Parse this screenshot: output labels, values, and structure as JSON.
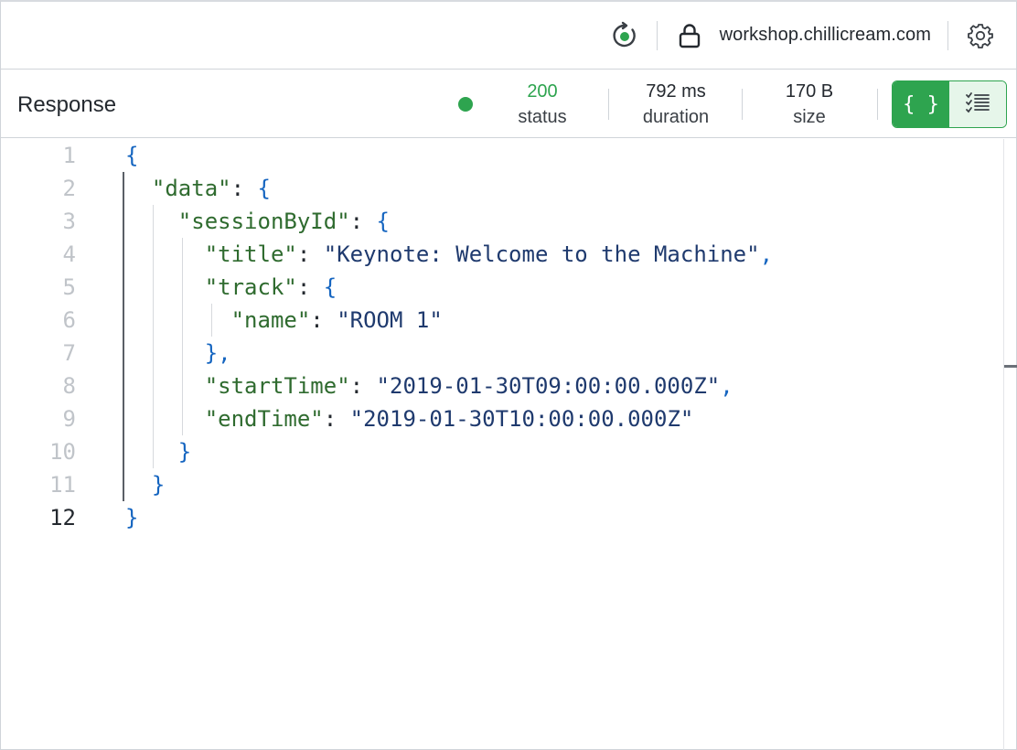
{
  "connection": {
    "url": "workshop.chillicream.com",
    "icons": {
      "refresh": "refresh-status-icon",
      "lock": "lock-icon",
      "settings": "gear-icon"
    }
  },
  "response": {
    "title": "Response",
    "status": {
      "value": "200",
      "label": "status"
    },
    "duration": {
      "value": "792 ms",
      "label": "duration"
    },
    "size": {
      "value": "170 B",
      "label": "size"
    },
    "view_toggle": {
      "json_label": "{ }",
      "tree_icon": "list-view-icon"
    }
  },
  "editor": {
    "current_line": 12,
    "lines": [
      {
        "n": "1",
        "tokens": [
          [
            "p",
            "{"
          ]
        ]
      },
      {
        "n": "2",
        "tokens": [
          [
            "k",
            "  \"data\""
          ],
          [
            "c",
            ": "
          ],
          [
            "p",
            "{"
          ]
        ]
      },
      {
        "n": "3",
        "tokens": [
          [
            "k",
            "    \"sessionById\""
          ],
          [
            "c",
            ": "
          ],
          [
            "p",
            "{"
          ]
        ]
      },
      {
        "n": "4",
        "tokens": [
          [
            "k",
            "      \"title\""
          ],
          [
            "c",
            ": "
          ],
          [
            "s",
            "\"Keynote: Welcome to the Machine\""
          ],
          [
            "p",
            ","
          ]
        ]
      },
      {
        "n": "5",
        "tokens": [
          [
            "k",
            "      \"track\""
          ],
          [
            "c",
            ": "
          ],
          [
            "p",
            "{"
          ]
        ]
      },
      {
        "n": "6",
        "tokens": [
          [
            "k",
            "        \"name\""
          ],
          [
            "c",
            ": "
          ],
          [
            "s",
            "\"ROOM 1\""
          ]
        ]
      },
      {
        "n": "7",
        "tokens": [
          [
            "p",
            "      },"
          ]
        ]
      },
      {
        "n": "8",
        "tokens": [
          [
            "k",
            "      \"startTime\""
          ],
          [
            "c",
            ": "
          ],
          [
            "s",
            "\"2019-01-30T09:00:00.000Z\""
          ],
          [
            "p",
            ","
          ]
        ]
      },
      {
        "n": "9",
        "tokens": [
          [
            "k",
            "      \"endTime\""
          ],
          [
            "c",
            ": "
          ],
          [
            "s",
            "\"2019-01-30T10:00:00.000Z\""
          ]
        ]
      },
      {
        "n": "10",
        "tokens": [
          [
            "p",
            "    }"
          ]
        ]
      },
      {
        "n": "11",
        "tokens": [
          [
            "p",
            "  }"
          ]
        ]
      },
      {
        "n": "12",
        "tokens": [
          [
            "p",
            "}"
          ]
        ]
      }
    ]
  },
  "colors": {
    "accent": "#2ea44f",
    "key": "#2f6b2f",
    "string": "#1f3a6e",
    "punct": "#1565c0"
  }
}
